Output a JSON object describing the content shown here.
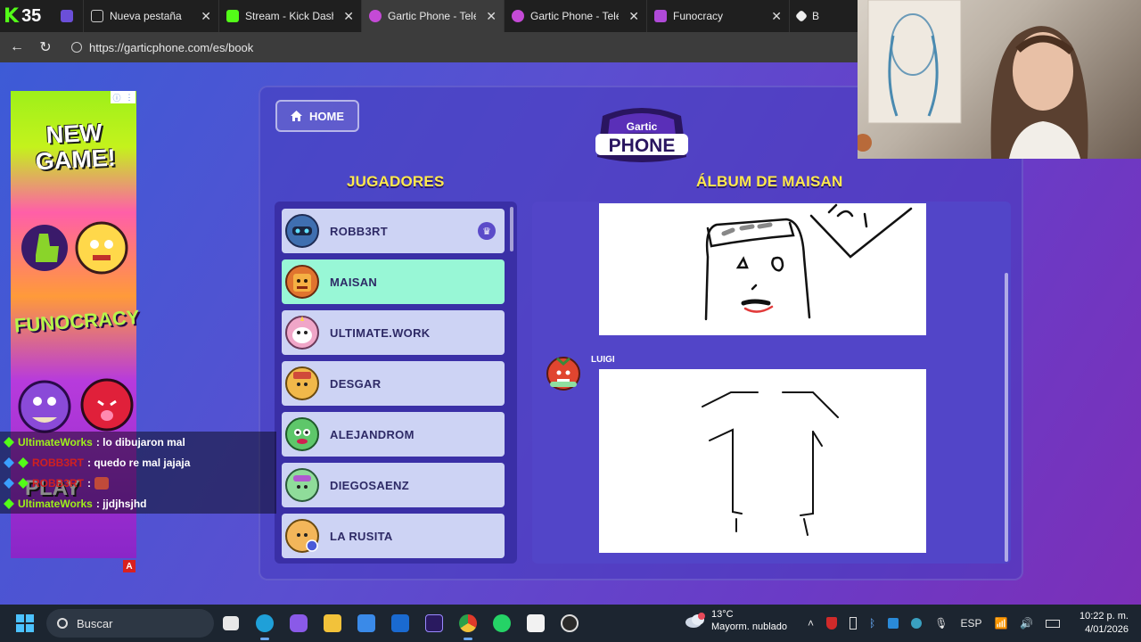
{
  "browser": {
    "kick_count": "35",
    "tabs": [
      {
        "label": "Nueva pestaña",
        "icon": "page-icon",
        "active": false
      },
      {
        "label": "Stream - Kick Dashboard",
        "icon": "kick-icon",
        "active": false
      },
      {
        "label": "Gartic Phone - Teléfono",
        "icon": "gartic-icon",
        "active": true
      },
      {
        "label": "Gartic Phone - Teléfono",
        "icon": "gartic-icon",
        "active": false
      },
      {
        "label": "Funocracy",
        "icon": "funocracy-icon",
        "active": false
      },
      {
        "label": "B",
        "icon": "generic-icon",
        "active": false
      }
    ],
    "url": "https://garticphone.com/es/book"
  },
  "game": {
    "home_label": "HOME",
    "logo_top": "Gartic",
    "logo_bottom": "PHONE",
    "players_title": "JUGADORES",
    "album_title": "ÁLBUM DE MAISAN",
    "players": [
      {
        "name": "ROBB3RT",
        "crown": true,
        "highlight": false,
        "color": "#3f6fb0"
      },
      {
        "name": "MAISAN",
        "crown": false,
        "highlight": true,
        "color": "#e0742f"
      },
      {
        "name": "ULTIMATE.WORK",
        "crown": false,
        "highlight": false,
        "color": "#f0a6c8"
      },
      {
        "name": "DESGAR",
        "crown": false,
        "highlight": false,
        "color": "#f1b84a"
      },
      {
        "name": "ALEJANDROM",
        "crown": false,
        "highlight": false,
        "color": "#5ec76a"
      },
      {
        "name": "DIEGOSAENZ",
        "crown": false,
        "highlight": false,
        "color": "#8fdc9a"
      },
      {
        "name": "LA RUSITA",
        "crown": false,
        "highlight": false,
        "color": "#f3b65a"
      }
    ],
    "album_author": "LUIGI"
  },
  "ad": {
    "new_game": "NEW GAME!",
    "brand": "FUNOCRACY",
    "play": "PLAY",
    "badge": "A"
  },
  "chat": [
    {
      "user": "UltimateWorks",
      "user_color": "#9ef01a",
      "message": ": lo dibujaron mal"
    },
    {
      "user": "ROBB3RT",
      "user_color": "#d02020",
      "message": ": quedo re mal jajaja"
    },
    {
      "user": "ROBB3RT",
      "user_color": "#d02020",
      "message": ":"
    },
    {
      "user": "UltimateWorks",
      "user_color": "#9ef01a",
      "message": ": jjdjhsjhd"
    }
  ],
  "taskbar": {
    "search_placeholder": "Buscar",
    "weather_temp": "13°C",
    "weather_desc": "Mayorm. nublado",
    "language": "ESP",
    "time": "10:22 p. m.",
    "date": "4/01/2026"
  }
}
